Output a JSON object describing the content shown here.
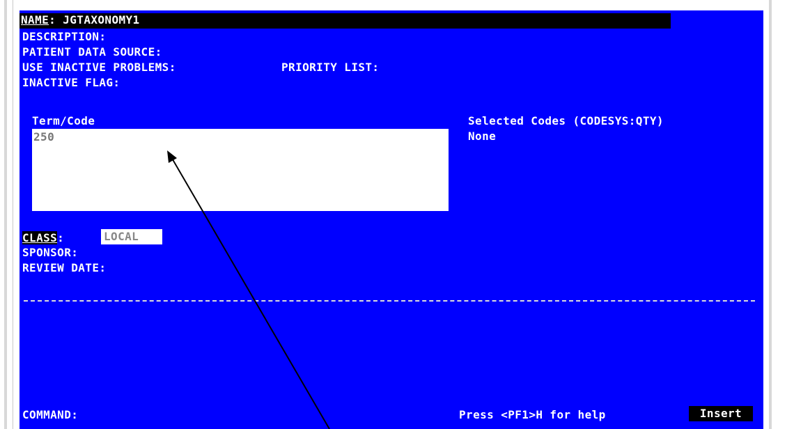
{
  "form": {
    "name_label": "NAME",
    "name_sep": ": ",
    "name_value": "JGTAXONOMY1",
    "description_label": "DESCRIPTION:",
    "patient_data_source_label": "PATIENT DATA SOURCE:",
    "use_inactive_problems_label": "USE INACTIVE PROBLEMS:",
    "priority_list_label": "PRIORITY LIST:",
    "inactive_flag_label": "INACTIVE FLAG:",
    "term_code_label": "Term/Code",
    "term_code_value": "250",
    "selected_codes_label": "Selected Codes (CODESYS:QTY)",
    "selected_codes_value": "None",
    "class_label": "CLASS",
    "class_sep": ":",
    "class_value": "LOCAL",
    "sponsor_label": "SPONSOR:",
    "review_date_label": "REVIEW DATE:"
  },
  "footer": {
    "command_label": "COMMAND:",
    "help_text": "Press <PF1>H for help",
    "mode_badge": "Insert"
  },
  "colors": {
    "screen_background": "#0000ff",
    "text": "#ffffff",
    "highlight": "#000000",
    "annotation_arrow": "#000000"
  }
}
